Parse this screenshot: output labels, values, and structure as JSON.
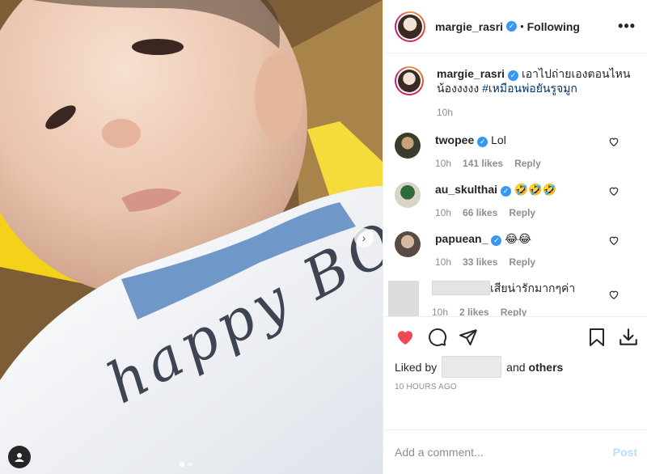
{
  "header": {
    "username": "margie_rasri",
    "separator": "•",
    "follow_status": "Following",
    "more_label": "•••"
  },
  "caption": {
    "username": "margie_rasri",
    "text": "เอาไปถ่ายเองตอนไหนน้องงงงง ",
    "hashtag": "#เหมือนพ่อยันรูจมูก",
    "time": "10h"
  },
  "comments": [
    {
      "username": "twopee",
      "text": "Lol",
      "time": "10h",
      "likes": "141 likes",
      "reply": "Reply",
      "verified": true
    },
    {
      "username": "au_skulthai",
      "text": "🤣🤣🤣",
      "time": "10h",
      "likes": "66 likes",
      "reply": "Reply",
      "verified": true
    },
    {
      "username": "papuean_",
      "text": "😂😂",
      "time": "10h",
      "likes": "33 likes",
      "reply": "Reply",
      "verified": true
    },
    {
      "username": "",
      "text": "เสียน่ารักมากๆค่า",
      "time": "10h",
      "likes": "2 likes",
      "reply": "Reply",
      "verified": false
    }
  ],
  "actions": {
    "liked_by_prefix": "Liked by",
    "liked_by_suffix": "and",
    "others": "others",
    "timestamp": "10 HOURS AGO"
  },
  "add_comment": {
    "placeholder": "Add a comment...",
    "post_label": "Post"
  },
  "photo": {
    "shirt_text": "happy BO",
    "carousel_dots": 2,
    "active_dot": 1
  },
  "colors": {
    "verified": "#3897f0",
    "like_red": "#ed4956",
    "post_disabled": "#b2dffc",
    "meta_gray": "#8e8e8e"
  },
  "icons": [
    "verified-icon",
    "more-icon",
    "heart-icon",
    "comment-icon",
    "share-icon",
    "bookmark-icon",
    "download-icon",
    "user-tag-icon",
    "next-arrow-icon"
  ]
}
